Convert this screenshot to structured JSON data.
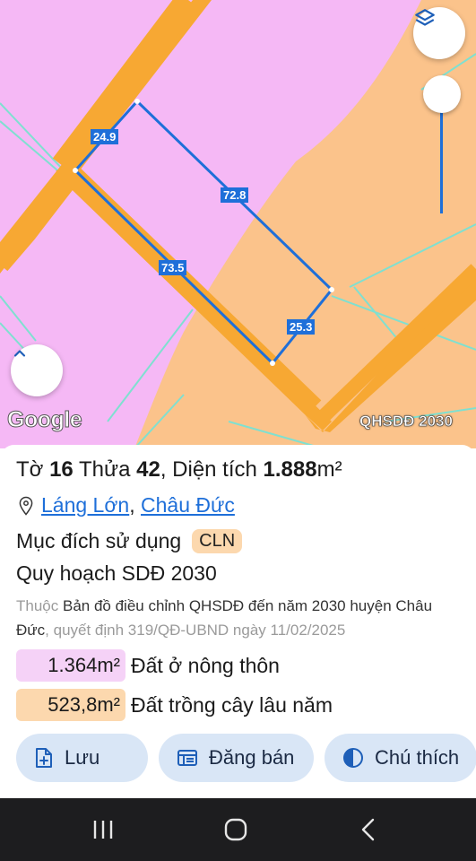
{
  "map": {
    "edge_labels": [
      "24.9",
      "72.8",
      "73.5",
      "25.3"
    ],
    "google_logo": "Google",
    "layer_badge": "QHSDĐ 2030",
    "colors": {
      "residential": "#f5b8f5",
      "perennial": "#fbc38b",
      "road": "#f7a833",
      "boundary": "#1e6fd9",
      "edge_label_bg": "#1e6fd9"
    }
  },
  "parcel": {
    "to_label": "Tờ",
    "to_value": "16",
    "thua_label": "Thửa",
    "thua_value": "42",
    "area_label": ", Diện tích",
    "area_value": "1.888",
    "area_unit": "m²",
    "commune": "Láng Lớn",
    "separator": ",",
    "district": "Châu Đức",
    "purpose_label": "Mục đích sử dụng",
    "purpose_code": "CLN",
    "plan_title": "Quy hoạch SDĐ 2030",
    "desc_prefix": "Thuộc",
    "desc_doc": "Bản đồ điều chỉnh QHSDĐ đến năm 2030 huyện Châu Đức",
    "desc_suffix": ", quyết định 319/QĐ-UBND ngày 11/02/2025",
    "areas": [
      {
        "value": "1.364m²",
        "label": "Đất ở nông thôn",
        "color": "#f5d2f7"
      },
      {
        "value": "523,8m²",
        "label": "Đất trồng cây lâu năm",
        "color": "#fcd8ae"
      }
    ]
  },
  "actions": {
    "save_label": "Lưu",
    "post_label": "Đăng bán",
    "legend_label": "Chú thích"
  },
  "icons": [
    "layers-icon",
    "chevron-up-icon",
    "location-pin-icon",
    "add-file-icon",
    "listing-icon",
    "contrast-icon",
    "recents-icon",
    "home-icon",
    "back-icon"
  ]
}
